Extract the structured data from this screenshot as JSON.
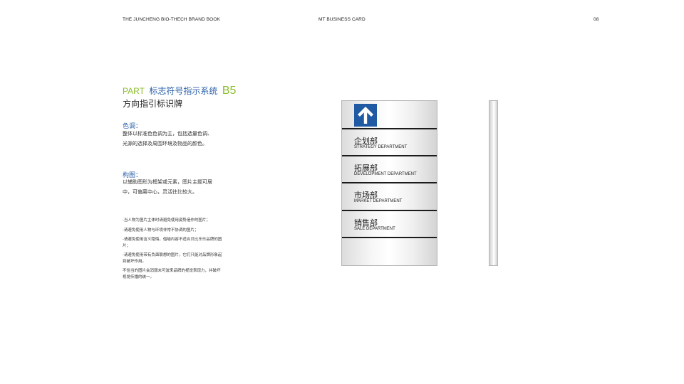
{
  "header": {
    "left": "THE JUNCHENG BIO-THECH BRAND BOOK",
    "center": "MT BUSINESS CARD",
    "page_number": "08"
  },
  "title": {
    "part": "PART",
    "cn": "标志符号指示系统",
    "code": "B5",
    "subtitle": "方向指引标识牌"
  },
  "section_color": {
    "heading": "色调：",
    "line1": "整体以标准色色调为主，包括选量色调、",
    "line2": "光源的选择及周围环境及物品的颜色。"
  },
  "section_composition": {
    "heading": "构图：",
    "line1": "以辅助图形为框架或元素，图片主题可居",
    "line2": "中，可偏离中心，灵活往比较大。"
  },
  "notes": [
    "-当人物为图片主体时请避免使用姿势造作的图片；",
    "-请避免使用人物与环境非常不协调的图片；",
    "-请避免使用含义隐悔，借喻内容不适合贝比乐乐品牌的图片；",
    "-请避免使用带有负面联想的图片，它们只能对品牌形象起到破坏作用。",
    "不恰当的图片会消弱未可波来品牌的视觉表现力，并破坏视觉传播的统一。"
  ],
  "sign": {
    "arrow_icon": "up-arrow-icon",
    "arrow_color": "#1f5aa3",
    "departments": [
      {
        "cn": "企划部",
        "en": "STRATEGY DEPARTMENT"
      },
      {
        "cn": "拓展部",
        "en": "DEVELOPMENT DEPARTMENT"
      },
      {
        "cn": "市场部",
        "en": "MARKET DEPARTMENT"
      },
      {
        "cn": "销售部",
        "en": "SALE DEPARTMENT"
      }
    ]
  },
  "colors": {
    "accent_green": "#8cbd2e",
    "accent_blue": "#2a5fa8"
  }
}
